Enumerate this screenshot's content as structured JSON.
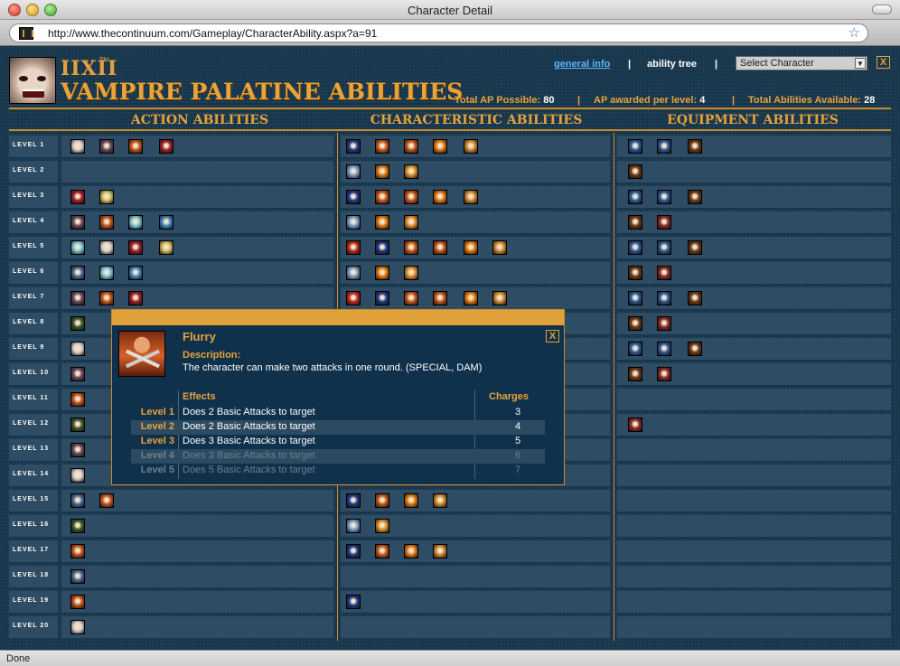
{
  "window": {
    "title": "Character Detail",
    "url": "http://www.thecontinuum.com/Gameplay/CharacterAbility.aspx?a=91",
    "status": "Done"
  },
  "header": {
    "logo_mark": "IIXII",
    "logo_tm": "TM",
    "title": "VAMPIRE PALATINE ABILITIES",
    "nav": {
      "general_info": "general info",
      "sep": "|",
      "ability_tree": "ability tree",
      "select_placeholder": "Select Character",
      "close": "X"
    },
    "stats": {
      "total_ap_label": "Total AP Possible:",
      "total_ap": "80",
      "ap_level_label": "AP awarded per level:",
      "ap_level": "4",
      "total_abilities_label": "Total Abilities Available:",
      "total_abilities": "28",
      "sep": "|"
    }
  },
  "columns": {
    "action": "ACTION ABILITIES",
    "characteristic": "CHARACTERISTIC ABILITIES",
    "equipment": "EQUIPMENT ABILITIES"
  },
  "rows": [
    {
      "label": "LEVEL 1",
      "action": [
        "face-white",
        "face-hood",
        "beast-orange",
        "face-red"
      ],
      "char": [
        "sword-blue",
        "fist-orange",
        "beast-orange",
        "flame-orange",
        "claw-orange"
      ],
      "equip": [
        "shield-blue",
        "shield-blue",
        "blade-brown"
      ]
    },
    {
      "label": "LEVEL 2",
      "action": [],
      "char": [
        "wave-blue",
        "flame-orange",
        "hand-orange"
      ],
      "equip": [
        "blade-brown"
      ]
    },
    {
      "label": "LEVEL 3",
      "action": [
        "face-red",
        "skull-yellow"
      ],
      "char": [
        "sword-blue",
        "fist-orange",
        "beast-orange",
        "flame-orange",
        "claw-orange"
      ],
      "equip": [
        "shield-blue",
        "shield-blue",
        "blade-brown"
      ]
    },
    {
      "label": "LEVEL 4",
      "action": [
        "face-hood",
        "beast-orange",
        "skull-cyan",
        "face-cyan"
      ],
      "char": [
        "wave-blue",
        "flame-orange",
        "hand-orange"
      ],
      "equip": [
        "blade-brown",
        "shield-red"
      ]
    },
    {
      "label": "LEVEL 5",
      "action": [
        "skull-cyan",
        "face-white",
        "face-red",
        "skull-yellow"
      ],
      "char": [
        "claw-red",
        "sword-blue",
        "fist-orange",
        "beast-orange",
        "flame-orange",
        "claw-orange"
      ],
      "equip": [
        "shield-blue",
        "shield-blue",
        "blade-brown"
      ]
    },
    {
      "label": "LEVEL 6",
      "action": [
        "beast-blue",
        "skull-cyan",
        "face-cyan"
      ],
      "char": [
        "wave-blue",
        "flame-orange",
        "hand-orange"
      ],
      "equip": [
        "blade-brown",
        "shield-red"
      ]
    },
    {
      "label": "LEVEL 7",
      "action": [
        "face-hood",
        "beast-orange",
        "face-red"
      ],
      "char": [
        "claw-red",
        "sword-blue",
        "fist-orange",
        "beast-orange",
        "flame-orange",
        "claw-orange"
      ],
      "equip": [
        "shield-blue",
        "shield-blue",
        "blade-brown"
      ]
    },
    {
      "label": "LEVEL 8",
      "action": [
        "cage-green"
      ],
      "char": [],
      "equip": [
        "blade-brown",
        "shield-red"
      ]
    },
    {
      "label": "LEVEL 9",
      "action": [
        "face-white"
      ],
      "char": [],
      "equip": [
        "shield-blue",
        "shield-blue",
        "blade-brown"
      ]
    },
    {
      "label": "LEVEL 10",
      "action": [
        "face-hood"
      ],
      "char": [],
      "equip": [
        "blade-brown",
        "shield-red"
      ]
    },
    {
      "label": "LEVEL 11",
      "action": [
        "beast-orange"
      ],
      "char": [],
      "equip": []
    },
    {
      "label": "LEVEL 12",
      "action": [
        "cage-green"
      ],
      "char": [],
      "equip": [
        "shield-red"
      ]
    },
    {
      "label": "LEVEL 13",
      "action": [
        "face-hood"
      ],
      "char": [],
      "equip": []
    },
    {
      "label": "LEVEL 14",
      "action": [
        "face-white"
      ],
      "char": [],
      "equip": []
    },
    {
      "label": "LEVEL 15",
      "action": [
        "beast-blue",
        "beast-orange"
      ],
      "char": [
        "sword-blue",
        "fist-orange",
        "flame-orange",
        "claw-orange"
      ],
      "equip": []
    },
    {
      "label": "LEVEL 16",
      "action": [
        "cage-green"
      ],
      "char": [
        "wave-blue",
        "hand-orange"
      ],
      "equip": []
    },
    {
      "label": "LEVEL 17",
      "action": [
        "beast-orange"
      ],
      "char": [
        "sword-blue",
        "fist-orange",
        "flame-orange",
        "claw-orange"
      ],
      "equip": []
    },
    {
      "label": "LEVEL 18",
      "action": [
        "beast-blue"
      ],
      "char": [],
      "equip": []
    },
    {
      "label": "LEVEL 19",
      "action": [
        "beast-orange"
      ],
      "char": [
        "sword-blue"
      ],
      "equip": []
    },
    {
      "label": "LEVEL 20",
      "action": [
        "face-white"
      ],
      "char": [],
      "equip": []
    }
  ],
  "icon_colors": {
    "face-white": "#d8d0cc",
    "face-hood": "#6a4a5a",
    "beast-orange": "#c4551c",
    "face-red": "#a0202a",
    "sword-blue": "#1c3a8a",
    "fist-orange": "#c85a1a",
    "flame-orange": "#e07a10",
    "claw-orange": "#d08a30",
    "shield-blue": "#2a5a9a",
    "blade-brown": "#6a3a1a",
    "wave-blue": "#7aa0c8",
    "hand-orange": "#e0902a",
    "skull-yellow": "#d0c060",
    "skull-cyan": "#7ac8d8",
    "face-cyan": "#3a8ac0",
    "claw-red": "#c02a1a",
    "beast-blue": "#4a6a9a",
    "shield-red": "#8a2a2a",
    "cage-green": "#3a5a2a"
  },
  "popup": {
    "name": "Flurry",
    "close": "X",
    "portrait_icon": "flurry-portrait",
    "description_label": "Description:",
    "description": "The character can make two attacks in one round. (SPECIAL, DAM)",
    "effects_label": "Effects",
    "charges_label": "Charges",
    "effects": [
      {
        "level": "Level 1",
        "effect": "Does 2 Basic Attacks to target",
        "charges": "3",
        "state": "active",
        "shaded": false
      },
      {
        "level": "Level 2",
        "effect": "Does 2 Basic Attacks to target",
        "charges": "4",
        "state": "active",
        "shaded": true
      },
      {
        "level": "Level 3",
        "effect": "Does 3 Basic Attacks to target",
        "charges": "5",
        "state": "active",
        "shaded": false
      },
      {
        "level": "Level 4",
        "effect": "Does 3 Basic Attacks to target",
        "charges": "6",
        "state": "dim",
        "shaded": true
      },
      {
        "level": "Level 5",
        "effect": "Does 5 Basic Attacks to target",
        "charges": "7",
        "state": "dim",
        "shaded": false
      }
    ]
  }
}
